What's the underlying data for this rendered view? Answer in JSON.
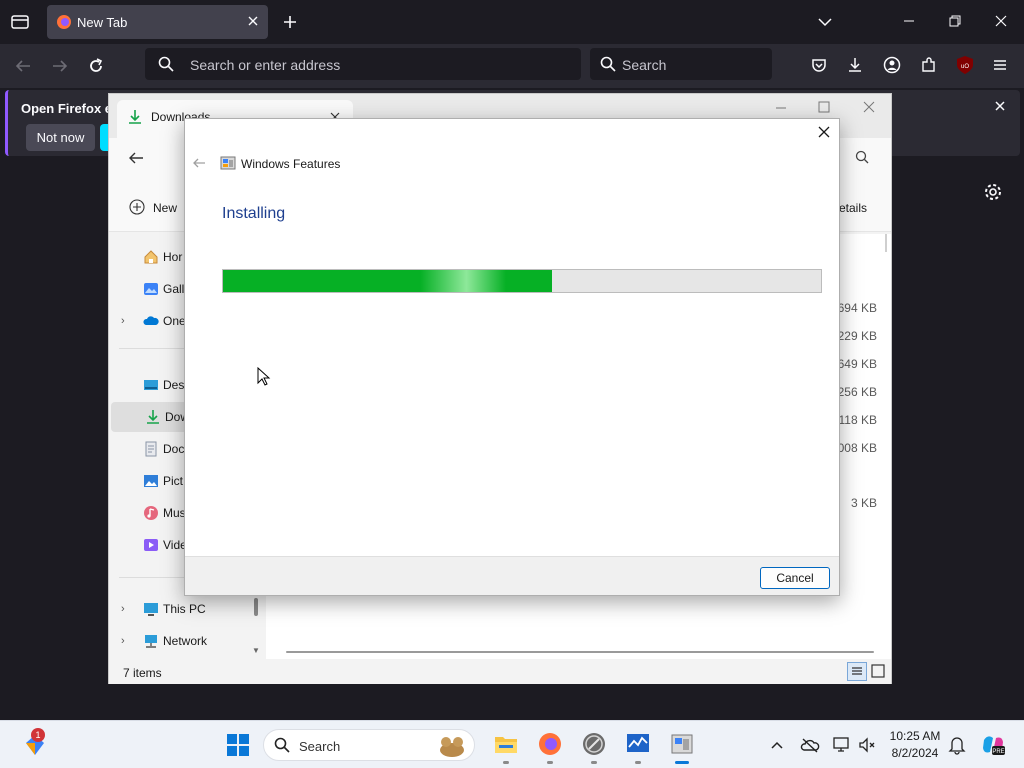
{
  "firefox": {
    "tab_title": "New Tab",
    "url_placeholder": "Search or enter address",
    "search_placeholder": "Search",
    "notification": {
      "message": "Open Firefox ev",
      "not_now_label": "Not now"
    }
  },
  "explorer": {
    "tab_title": "Downloads",
    "new_label": "New",
    "details_label": "etails",
    "sidebar": [
      {
        "label": "Hor",
        "icon": "home-icon"
      },
      {
        "label": "Gall",
        "icon": "gallery-icon"
      },
      {
        "label": "One",
        "icon": "onedrive-icon"
      },
      {
        "label": "Desl",
        "icon": "desktop-icon"
      },
      {
        "label": "Dow",
        "icon": "download-icon"
      },
      {
        "label": "Doc",
        "icon": "documents-icon"
      },
      {
        "label": "Pict",
        "icon": "pictures-icon"
      },
      {
        "label": "Mus",
        "icon": "music-icon"
      },
      {
        "label": "Vide",
        "icon": "videos-icon"
      },
      {
        "label": "This PC",
        "icon": "this-pc-icon"
      },
      {
        "label": "Network",
        "icon": "network-icon"
      }
    ],
    "sizes": [
      "694 KB",
      "229 KB",
      "649 KB",
      "256 KB",
      "118 KB",
      "008 KB",
      "3 KB"
    ],
    "status": "7 items"
  },
  "dialog": {
    "title": "Windows Features",
    "heading": "Installing",
    "progress": 0.55,
    "cancel_label": "Cancel"
  },
  "taskbar": {
    "search_label": "Search",
    "time": "10:25 AM",
    "date": "8/2/2024",
    "notification_badge": "1"
  }
}
